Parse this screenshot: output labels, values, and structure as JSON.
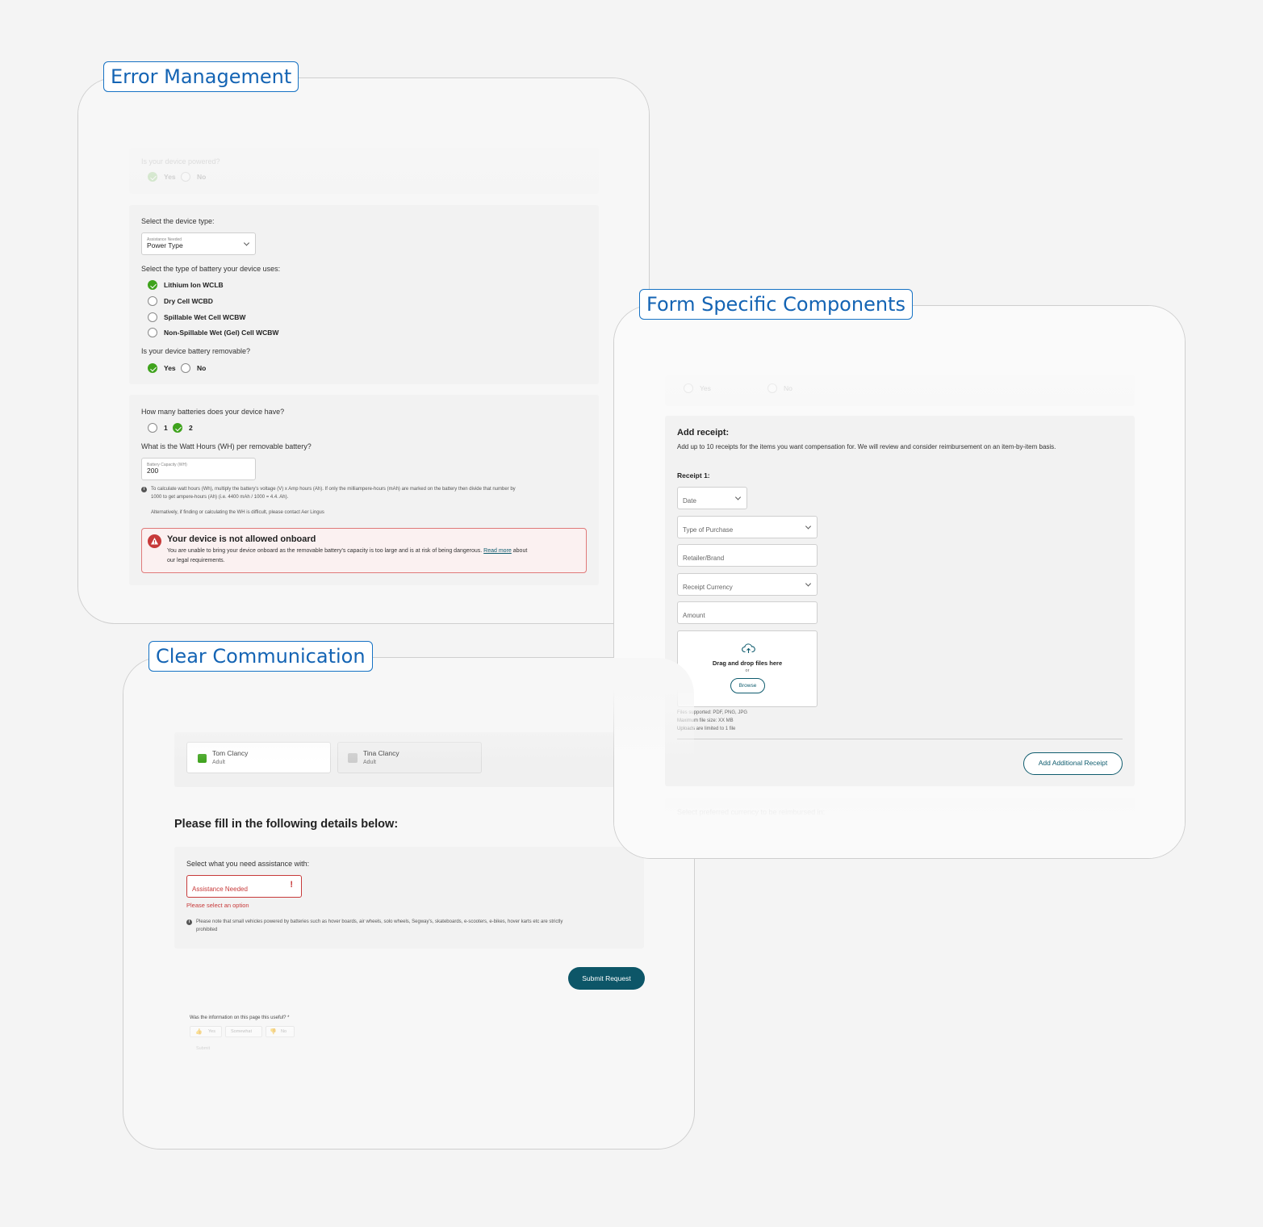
{
  "error_management": {
    "tag": "Error Management",
    "powered": {
      "question": "Is your device powered?",
      "yes": "Yes",
      "no": "No"
    },
    "device_type_label": "Select the device type:",
    "device_select": {
      "label": "Assistance Needed",
      "value": "Power Type"
    },
    "battery_question": "Select the type of battery your device uses:",
    "battery_options": [
      "Lithium Ion WCLB",
      "Dry Cell WCBD",
      "Spillable Wet Cell WCBW",
      "Non-Spillable Wet (Gel) Cell WCBW"
    ],
    "battery_selected_index": 0,
    "removable": {
      "question": "Is your device battery removable?",
      "yes": "Yes",
      "no": "No",
      "selected": "Yes"
    },
    "count": {
      "question": "How many batteries does your device have?",
      "opt1": "1",
      "opt2": "2",
      "selected": "2"
    },
    "watt_question": "What is the Watt Hours (WH) per removable battery?",
    "capacity_field": {
      "label": "Battery Capacity (WH)",
      "value": "200"
    },
    "info_line1": "To calculate watt hours (Wh), multiply the battery's voltage (V) x Amp hours (Ah). If only the milliampere-hours (mAh) are marked on the battery then divide that number by",
    "info_line2": "1000 to get ampere-hours (Ah) (i.e. 4400 mAh / 1000 = 4.4. Ah).",
    "info_line3": "Alternatively, if finding or calculating the WH is difficult, please contact Aer Lingus",
    "alert": {
      "title": "Your device is not allowed onboard",
      "body_start": "You are unable to bring your device onboard as the removable battery's capacity is too large and is at risk of being dangerous.",
      "link": "Read more",
      "body_end": "about",
      "body_line2": "our legal requirements.",
      "icon": "warning-icon"
    }
  },
  "form_components": {
    "tag": "Form Specific Components",
    "faded_yes": "Yes",
    "faded_no": "No",
    "title": "Add receipt:",
    "subtitle": "Add up to 10 receipts for the items you want compensation for. We will review and consider reimbursement on an item-by-item basis.",
    "receipt_label": "Receipt 1:",
    "date_placeholder": "Date",
    "purchase_placeholder": "Type of Purchase",
    "retailer_placeholder": "Retailer/Brand",
    "currency_placeholder": "Receipt Currency",
    "amount_placeholder": "Amount",
    "upload": {
      "title": "Drag and drop files here",
      "or": "or",
      "browse": "Browse",
      "icon": "cloud-upload-icon"
    },
    "file_notes": [
      "Files supported: PDF, PNG, JPG",
      "Maximum file size: XX MB",
      "Uploads are limited to 1 file"
    ],
    "add_button": "Add Additional Receipt",
    "faded_footer": "Select preferred currency to be reimbursed in:"
  },
  "clear_communication": {
    "tag": "Clear Communication",
    "passengers": [
      {
        "name": "Tom Clancy",
        "type": "Adult",
        "checked": true
      },
      {
        "name": "Tina Clancy",
        "type": "Adult",
        "checked": false
      }
    ],
    "heading": "Please fill in the following details below:",
    "assist_label": "Select what you need assistance with:",
    "assist_placeholder": "Assistance Needed",
    "error_text": "Please select an option",
    "note_line1": "Please note that small vehicles powered by batteries such as hover boards, air wheels, solo wheels, Segway's, skateboards, e-scooters, e-bikes, hover karts etc are strictly",
    "note_line2": "prohibited",
    "submit": "Submit Request",
    "feedback": {
      "question": "Was the information on this page this useful? *",
      "yes": "Yes",
      "somewhat": "Somewhat",
      "no": "No",
      "submit": "Submit"
    }
  },
  "colors": {
    "tag_border": "#1672c4",
    "check_green": "#3fa31d",
    "error_red": "#c73a3a",
    "button_teal": "#0d5668"
  }
}
